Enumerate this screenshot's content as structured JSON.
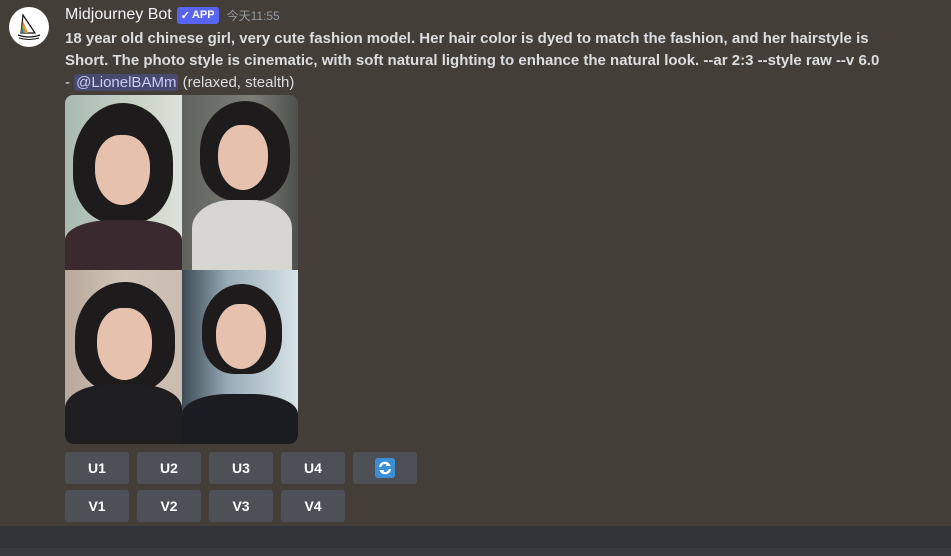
{
  "message": {
    "username": "Midjourney Bot",
    "badge": "APP",
    "timestamp": "今天11:55",
    "prompt": "18 year old chinese girl, very cute fashion model. Her hair color is dyed to match the fashion, and her hairstyle is Short. The photo style is cinematic, with soft natural lighting to enhance the natural look. --ar 2:3 --style raw --v 6.0",
    "dash": "-",
    "mention": "@LionelBAMm",
    "mode": "(relaxed, stealth)"
  },
  "buttons": {
    "upscale": [
      "U1",
      "U2",
      "U3",
      "U4"
    ],
    "variation": [
      "V1",
      "V2",
      "V3",
      "V4"
    ],
    "reroll_icon": "refresh-icon"
  },
  "colors": {
    "accent": "#5865f2",
    "button": "#4e5058",
    "background": "#433e38"
  }
}
